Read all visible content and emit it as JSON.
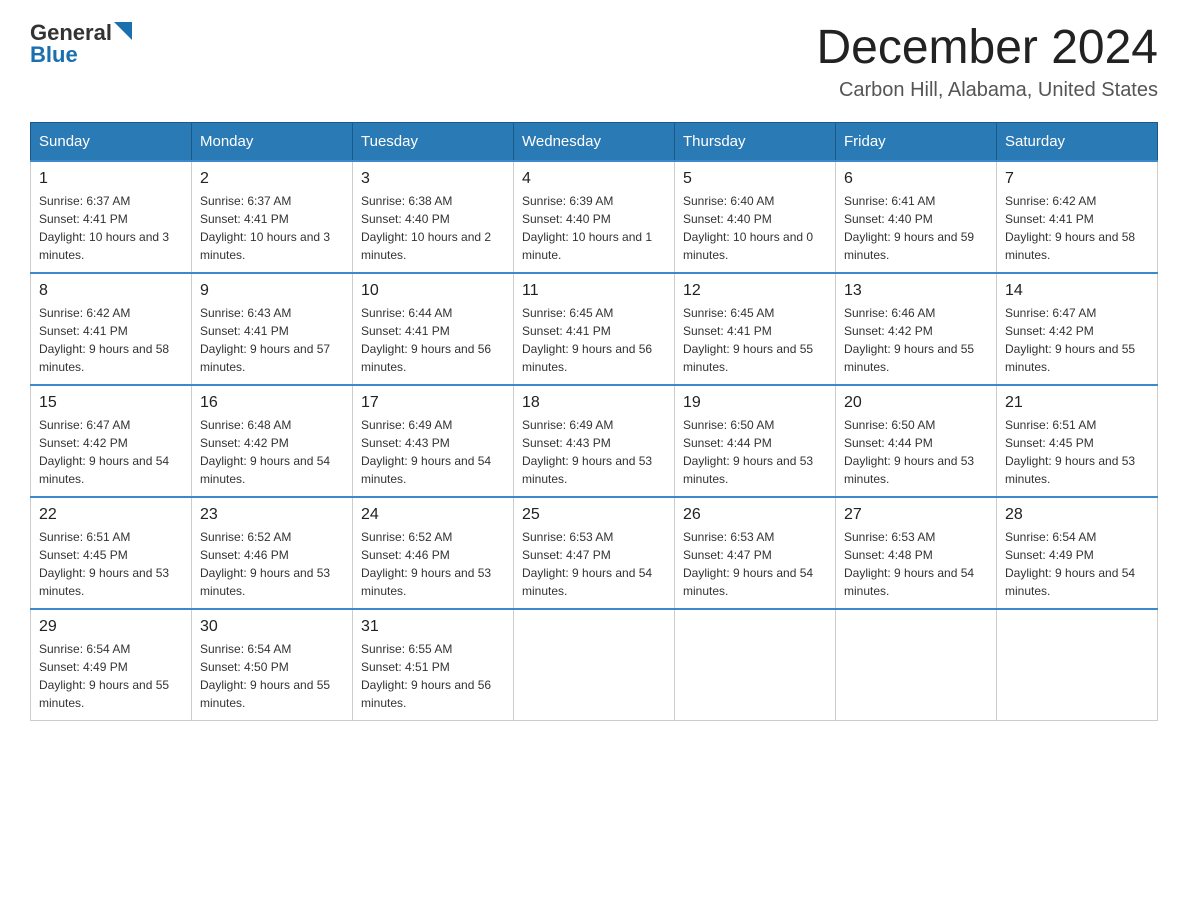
{
  "header": {
    "logo": {
      "general": "General",
      "blue": "Blue"
    },
    "title": "December 2024",
    "location": "Carbon Hill, Alabama, United States"
  },
  "weekdays": [
    "Sunday",
    "Monday",
    "Tuesday",
    "Wednesday",
    "Thursday",
    "Friday",
    "Saturday"
  ],
  "weeks": [
    [
      {
        "day": "1",
        "sunrise": "6:37 AM",
        "sunset": "4:41 PM",
        "daylight": "10 hours and 3 minutes."
      },
      {
        "day": "2",
        "sunrise": "6:37 AM",
        "sunset": "4:41 PM",
        "daylight": "10 hours and 3 minutes."
      },
      {
        "day": "3",
        "sunrise": "6:38 AM",
        "sunset": "4:40 PM",
        "daylight": "10 hours and 2 minutes."
      },
      {
        "day": "4",
        "sunrise": "6:39 AM",
        "sunset": "4:40 PM",
        "daylight": "10 hours and 1 minute."
      },
      {
        "day": "5",
        "sunrise": "6:40 AM",
        "sunset": "4:40 PM",
        "daylight": "10 hours and 0 minutes."
      },
      {
        "day": "6",
        "sunrise": "6:41 AM",
        "sunset": "4:40 PM",
        "daylight": "9 hours and 59 minutes."
      },
      {
        "day": "7",
        "sunrise": "6:42 AM",
        "sunset": "4:41 PM",
        "daylight": "9 hours and 58 minutes."
      }
    ],
    [
      {
        "day": "8",
        "sunrise": "6:42 AM",
        "sunset": "4:41 PM",
        "daylight": "9 hours and 58 minutes."
      },
      {
        "day": "9",
        "sunrise": "6:43 AM",
        "sunset": "4:41 PM",
        "daylight": "9 hours and 57 minutes."
      },
      {
        "day": "10",
        "sunrise": "6:44 AM",
        "sunset": "4:41 PM",
        "daylight": "9 hours and 56 minutes."
      },
      {
        "day": "11",
        "sunrise": "6:45 AM",
        "sunset": "4:41 PM",
        "daylight": "9 hours and 56 minutes."
      },
      {
        "day": "12",
        "sunrise": "6:45 AM",
        "sunset": "4:41 PM",
        "daylight": "9 hours and 55 minutes."
      },
      {
        "day": "13",
        "sunrise": "6:46 AM",
        "sunset": "4:42 PM",
        "daylight": "9 hours and 55 minutes."
      },
      {
        "day": "14",
        "sunrise": "6:47 AM",
        "sunset": "4:42 PM",
        "daylight": "9 hours and 55 minutes."
      }
    ],
    [
      {
        "day": "15",
        "sunrise": "6:47 AM",
        "sunset": "4:42 PM",
        "daylight": "9 hours and 54 minutes."
      },
      {
        "day": "16",
        "sunrise": "6:48 AM",
        "sunset": "4:42 PM",
        "daylight": "9 hours and 54 minutes."
      },
      {
        "day": "17",
        "sunrise": "6:49 AM",
        "sunset": "4:43 PM",
        "daylight": "9 hours and 54 minutes."
      },
      {
        "day": "18",
        "sunrise": "6:49 AM",
        "sunset": "4:43 PM",
        "daylight": "9 hours and 53 minutes."
      },
      {
        "day": "19",
        "sunrise": "6:50 AM",
        "sunset": "4:44 PM",
        "daylight": "9 hours and 53 minutes."
      },
      {
        "day": "20",
        "sunrise": "6:50 AM",
        "sunset": "4:44 PM",
        "daylight": "9 hours and 53 minutes."
      },
      {
        "day": "21",
        "sunrise": "6:51 AM",
        "sunset": "4:45 PM",
        "daylight": "9 hours and 53 minutes."
      }
    ],
    [
      {
        "day": "22",
        "sunrise": "6:51 AM",
        "sunset": "4:45 PM",
        "daylight": "9 hours and 53 minutes."
      },
      {
        "day": "23",
        "sunrise": "6:52 AM",
        "sunset": "4:46 PM",
        "daylight": "9 hours and 53 minutes."
      },
      {
        "day": "24",
        "sunrise": "6:52 AM",
        "sunset": "4:46 PM",
        "daylight": "9 hours and 53 minutes."
      },
      {
        "day": "25",
        "sunrise": "6:53 AM",
        "sunset": "4:47 PM",
        "daylight": "9 hours and 54 minutes."
      },
      {
        "day": "26",
        "sunrise": "6:53 AM",
        "sunset": "4:47 PM",
        "daylight": "9 hours and 54 minutes."
      },
      {
        "day": "27",
        "sunrise": "6:53 AM",
        "sunset": "4:48 PM",
        "daylight": "9 hours and 54 minutes."
      },
      {
        "day": "28",
        "sunrise": "6:54 AM",
        "sunset": "4:49 PM",
        "daylight": "9 hours and 54 minutes."
      }
    ],
    [
      {
        "day": "29",
        "sunrise": "6:54 AM",
        "sunset": "4:49 PM",
        "daylight": "9 hours and 55 minutes."
      },
      {
        "day": "30",
        "sunrise": "6:54 AM",
        "sunset": "4:50 PM",
        "daylight": "9 hours and 55 minutes."
      },
      {
        "day": "31",
        "sunrise": "6:55 AM",
        "sunset": "4:51 PM",
        "daylight": "9 hours and 56 minutes."
      },
      null,
      null,
      null,
      null
    ]
  ]
}
